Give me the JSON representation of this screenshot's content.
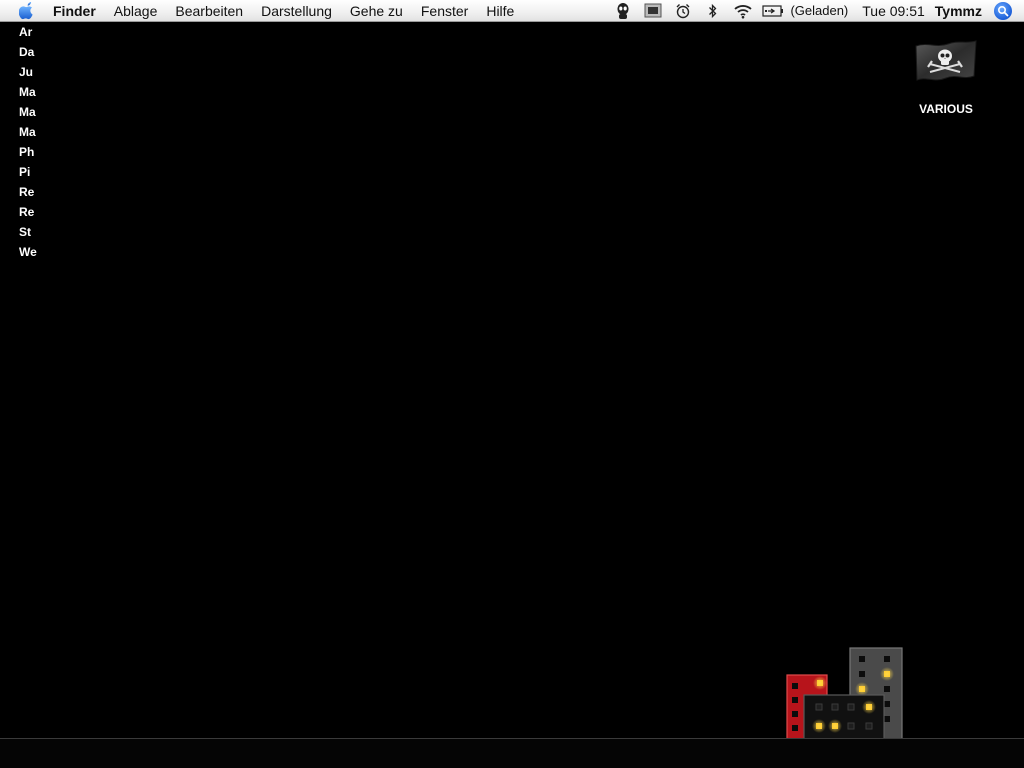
{
  "menubar": {
    "apple_icon": "apple-icon",
    "app_name": "Finder",
    "menus": [
      "Ablage",
      "Bearbeiten",
      "Darstellung",
      "Gehe zu",
      "Fenster",
      "Hilfe"
    ],
    "status_icons": [
      "alien-icon",
      "screen-icon",
      "alarm-clock-icon",
      "bluetooth-icon",
      "wifi-icon",
      "battery-icon"
    ],
    "battery_status": "(Geladen)",
    "clock": "Tue 09:51",
    "user": "Tymmz",
    "spotlight_icon": "search-icon"
  },
  "desktop_list": [
    "Ar",
    "Da",
    "Ju",
    "Ma",
    "Ma",
    "Ma",
    "Ph",
    "Pi",
    "Re",
    "Re",
    "St",
    "We"
  ],
  "desktop_icon": {
    "icon": "pirate-flag-icon",
    "label": "VARIOUS"
  },
  "colors": {
    "desktop_background": "#000000",
    "menubar": "#f2f2f2",
    "red_building": "#c0181e",
    "window_light": "#ffc21a"
  }
}
